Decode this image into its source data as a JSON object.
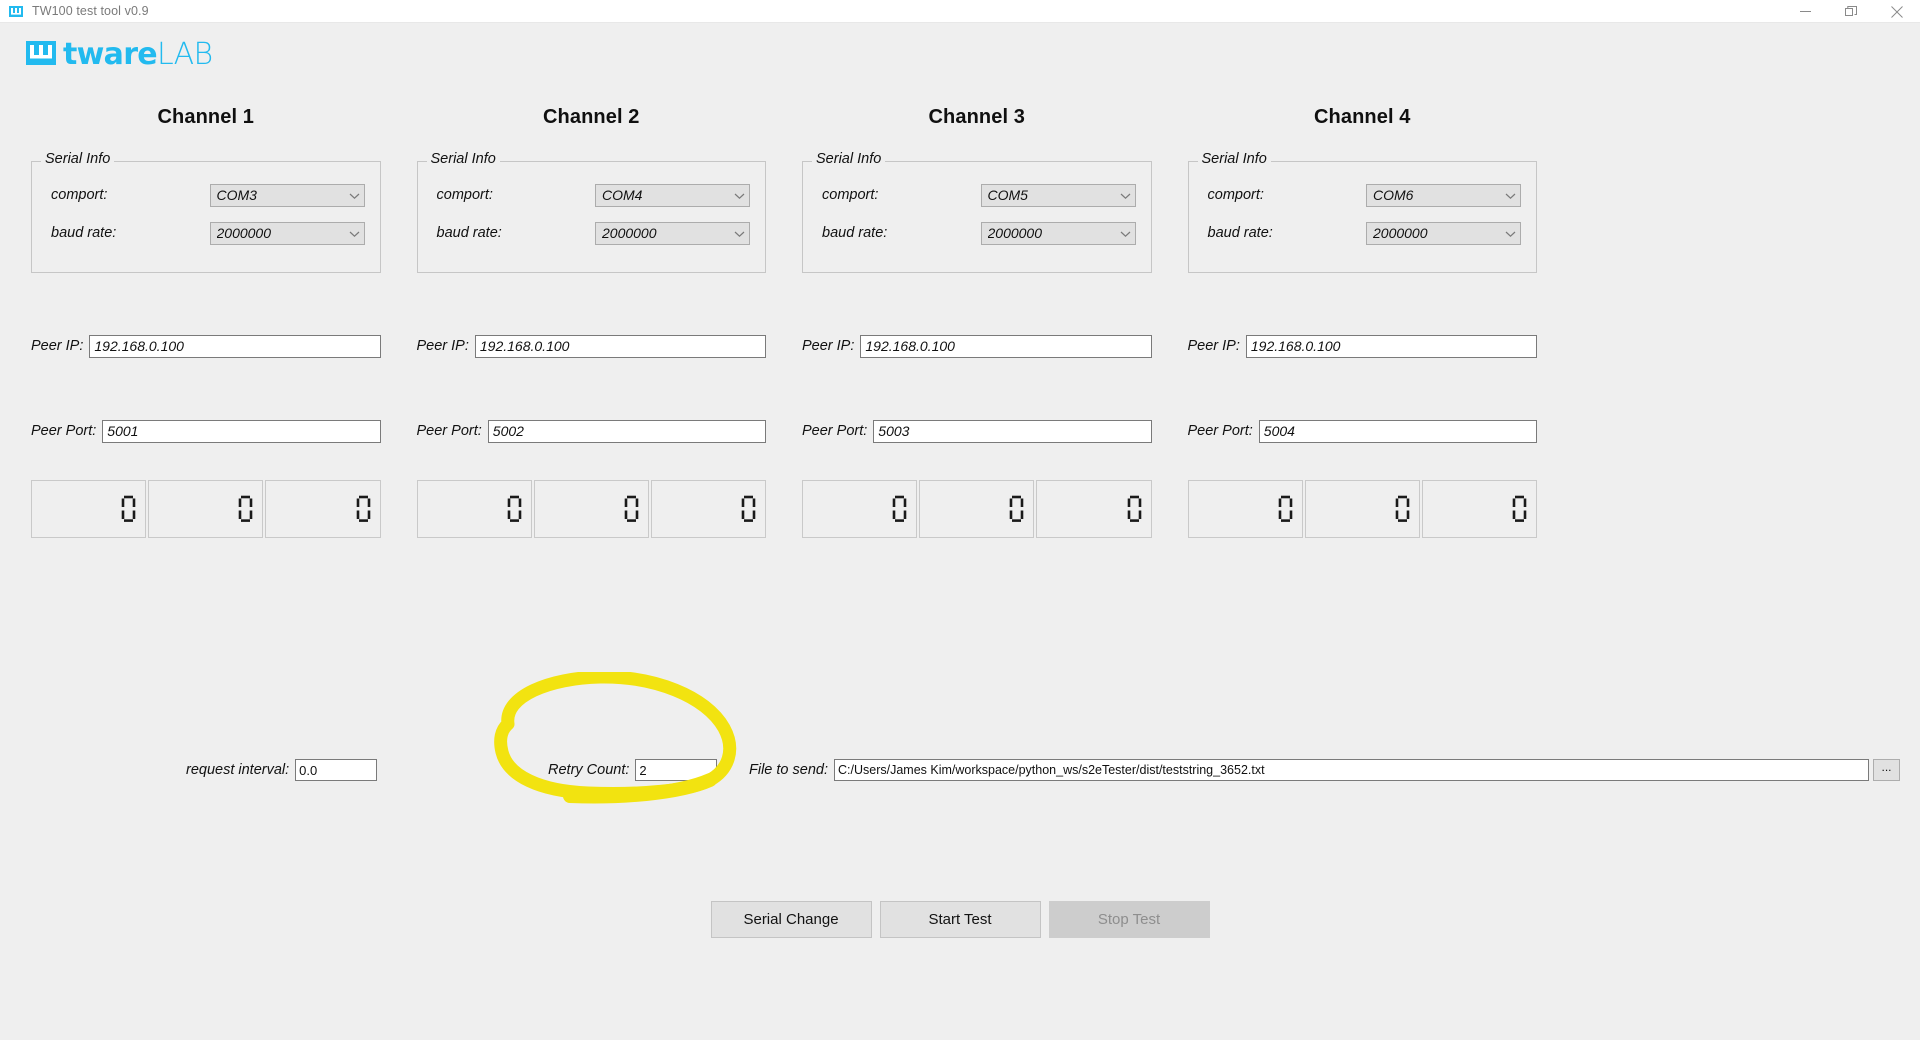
{
  "window": {
    "title": "TW100 test tool v0.9",
    "icon": "app-icon",
    "controls": {
      "minimize": "minimize-icon",
      "restore": "restore-icon",
      "close": "close-icon"
    }
  },
  "brand": {
    "mark": "tware-logo-mark",
    "name_bold": "tware",
    "name_light": "LAB",
    "color": "#22baef"
  },
  "labels": {
    "serial_info": "Serial Info",
    "comport": "comport:",
    "baud_rate": "baud rate:",
    "peer_ip": "Peer IP:",
    "peer_port": "Peer Port:"
  },
  "channels": [
    {
      "title": "Channel 1",
      "comport": "COM3",
      "baud_rate": "2000000",
      "peer_ip": "192.168.0.100",
      "peer_port": "5001",
      "counters": [
        "0",
        "0",
        "0"
      ]
    },
    {
      "title": "Channel 2",
      "comport": "COM4",
      "baud_rate": "2000000",
      "peer_ip": "192.168.0.100",
      "peer_port": "5002",
      "counters": [
        "0",
        "0",
        "0"
      ]
    },
    {
      "title": "Channel 3",
      "comport": "COM5",
      "baud_rate": "2000000",
      "peer_ip": "192.168.0.100",
      "peer_port": "5003",
      "counters": [
        "0",
        "0",
        "0"
      ]
    },
    {
      "title": "Channel 4",
      "comport": "COM6",
      "baud_rate": "2000000",
      "peer_ip": "192.168.0.100",
      "peer_port": "5004",
      "counters": [
        "0",
        "0",
        "0"
      ]
    }
  ],
  "settings": {
    "request_interval_label": "request interval:",
    "request_interval_value": "0.0",
    "retry_count_label": "Retry Count:",
    "retry_count_value": "2",
    "file_to_send_label": "File to send:",
    "file_to_send_value": "C:/Users/James Kim/workspace/python_ws/s2eTester/dist/teststring_3652.txt",
    "browse_label": "..."
  },
  "actions": {
    "serial_change": "Serial Change",
    "start_test": "Start Test",
    "stop_test": "Stop Test"
  },
  "annotation": {
    "shape": "hand-drawn-ellipse",
    "color": "#f2e310",
    "targets": "Retry Count"
  }
}
